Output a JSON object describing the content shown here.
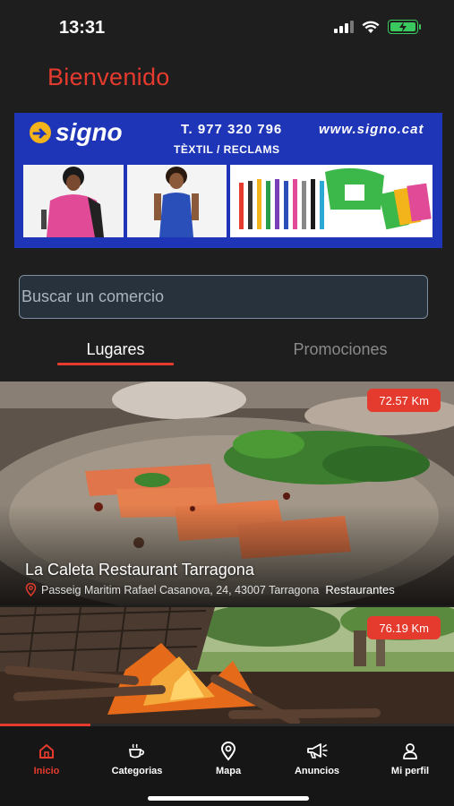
{
  "status_bar": {
    "time": "13:31"
  },
  "header": {
    "title": "Bienvenido"
  },
  "banner": {
    "logo_text": "signo",
    "phone": "T. 977 320 796",
    "website": "www.signo.cat",
    "tagline": "TÈXTIL / RECLAMS"
  },
  "search": {
    "placeholder": "Buscar un comercio"
  },
  "tabs": [
    {
      "label": "Lugares",
      "active": true
    },
    {
      "label": "Promociones",
      "active": false
    }
  ],
  "places": [
    {
      "name": "La Caleta Restaurant Tarragona",
      "address": "Passeig Maritim Rafael Casanova, 24, 43007 Tarragona",
      "category": "Restaurantes",
      "distance": "72.57 Km"
    },
    {
      "name": "",
      "address": "",
      "category": "",
      "distance": "76.19 Km"
    }
  ],
  "carousel_progress": 0.2,
  "nav": [
    {
      "label": "Inicio",
      "icon": "home-icon",
      "active": true
    },
    {
      "label": "Categorias",
      "icon": "coffee-cup-icon",
      "active": false
    },
    {
      "label": "Mapa",
      "icon": "map-pin-icon",
      "active": false
    },
    {
      "label": "Anuncios",
      "icon": "megaphone-icon",
      "active": false
    },
    {
      "label": "Mi perfil",
      "icon": "user-icon",
      "active": false
    }
  ],
  "colors": {
    "accent": "#e53b2e",
    "background": "#1e1e1e",
    "banner": "#1f35b8"
  }
}
